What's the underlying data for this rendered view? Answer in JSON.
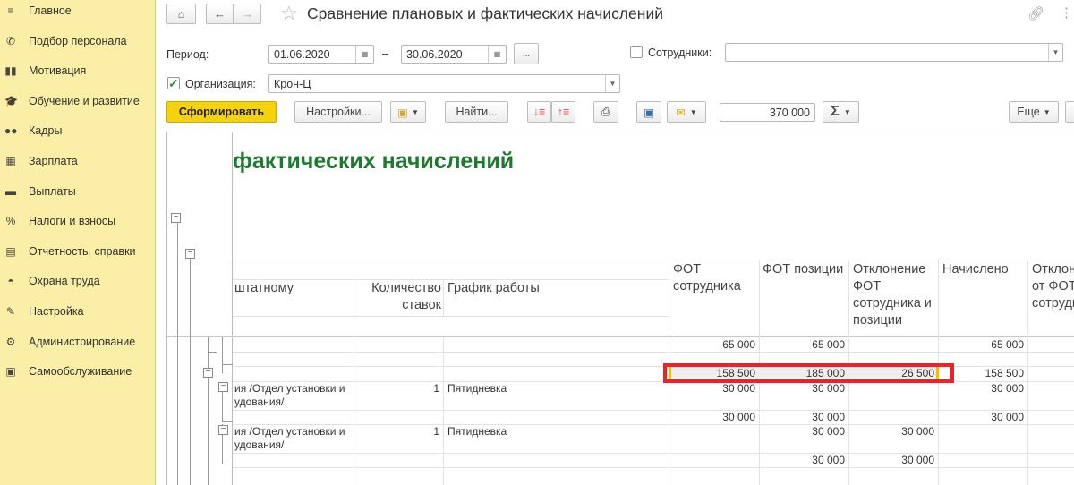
{
  "sidebar": {
    "items": [
      {
        "label": "Главное",
        "icon": "menu-icon",
        "glyph": "≡"
      },
      {
        "label": "Подбор персонала",
        "icon": "phone-icon",
        "glyph": "✆"
      },
      {
        "label": "Мотивация",
        "icon": "gift-icon",
        "glyph": "▮▮"
      },
      {
        "label": "Обучение и развитие",
        "icon": "graduation-cap-icon",
        "glyph": "🎓"
      },
      {
        "label": "Кадры",
        "icon": "people-icon",
        "glyph": "●●"
      },
      {
        "label": "Зарплата",
        "icon": "calculator-icon",
        "glyph": "▦"
      },
      {
        "label": "Выплаты",
        "icon": "wallet-icon",
        "glyph": "▬"
      },
      {
        "label": "Налоги и взносы",
        "icon": "percent-icon",
        "glyph": "%"
      },
      {
        "label": "Отчетность, справки",
        "icon": "report-icon",
        "glyph": "▤"
      },
      {
        "label": "Охрана труда",
        "icon": "helmet-icon",
        "glyph": "◓"
      },
      {
        "label": "Настройка",
        "icon": "wrench-icon",
        "glyph": "✎"
      },
      {
        "label": "Администрирование",
        "icon": "gear-icon",
        "glyph": "⚙"
      },
      {
        "label": "Самообслуживание",
        "icon": "id-card-icon",
        "glyph": "▣"
      }
    ]
  },
  "header": {
    "title": "Сравнение плановых и фактических начислений"
  },
  "form": {
    "period_label": "Период:",
    "date_from": "01.06.2020",
    "dash": "–",
    "date_to": "30.06.2020",
    "period_more": "...",
    "employees_label": "Сотрудники:",
    "employees_value": "",
    "org_label": "Организация:",
    "org_value": "Крон-Ц",
    "org_checked": true,
    "employees_checked": false
  },
  "toolbar": {
    "generate": "Сформировать",
    "settings": "Настройки...",
    "find": "Найти...",
    "sum_value": "370 000",
    "more": "Еще",
    "sigma": "Σ"
  },
  "report": {
    "title_fragment": "фактических начислений",
    "headers": {
      "name": "штатному",
      "qty": "Количество ставок",
      "schedule": "График работы",
      "fot_emp": "ФОТ сотрудника",
      "fot_pos": "ФОТ позиции",
      "deviation": "Отклонение ФОТ сотрудника и позиции",
      "accrued": "Начислено",
      "deviation2": "Отклонение от ФОТ сотрудника"
    },
    "rows": [
      {
        "name": "",
        "qty": "",
        "schedule": "",
        "fot_emp": "65 000",
        "fot_pos": "65 000",
        "dev": "",
        "acc": "65 000"
      },
      {
        "name": "",
        "qty": "",
        "schedule": "",
        "fot_emp": "",
        "fot_pos": "",
        "dev": "",
        "acc": ""
      },
      {
        "name": "",
        "qty": "",
        "schedule": "",
        "fot_emp": "158 500",
        "fot_pos": "185 000",
        "dev": "26 500",
        "acc": "158 500"
      },
      {
        "name": "ия /Отдел установки и удования/",
        "qty": "1",
        "schedule": "Пятидневка",
        "fot_emp": "30 000",
        "fot_pos": "30 000",
        "dev": "",
        "acc": "30 000"
      },
      {
        "name": "",
        "qty": "",
        "schedule": "",
        "fot_emp": "30 000",
        "fot_pos": "30 000",
        "dev": "",
        "acc": "30 000"
      },
      {
        "name": "ия /Отдел установки и удования/",
        "qty": "1",
        "schedule": "Пятидневка",
        "fot_emp": "",
        "fot_pos": "30 000",
        "dev": "30 000",
        "acc": ""
      },
      {
        "name": "",
        "qty": "",
        "schedule": "",
        "fot_emp": "",
        "fot_pos": "30 000",
        "dev": "30 000",
        "acc": ""
      }
    ]
  },
  "colors": {
    "sidebar": "#fbeea6",
    "generate": "#f5d20a",
    "title_green": "#1d7a2e",
    "highlight": "#e8232a"
  }
}
